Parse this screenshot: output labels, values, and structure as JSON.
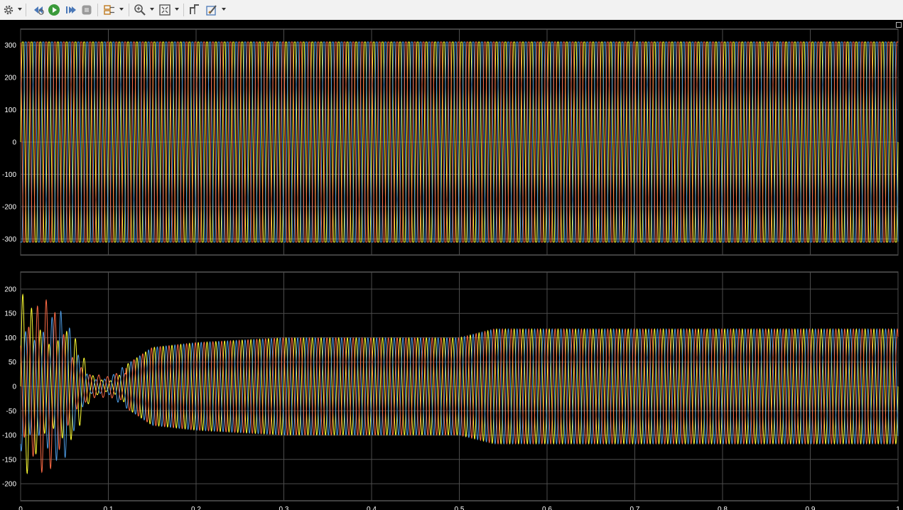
{
  "toolbar": {
    "icons": [
      "gear-icon",
      "step-back-icon",
      "run-icon",
      "step-forward-icon",
      "stop-icon",
      "highlight-icon",
      "zoom-in-icon",
      "fit-to-view-icon",
      "cursor-measure-icon",
      "triggers-icon"
    ]
  },
  "colors": {
    "background": "#000000",
    "grid": "#4d4d4d",
    "axes_frame": "#7f7f7f",
    "tick_text": "#ffffff",
    "phase_a": "#ffff33",
    "phase_b": "#4e9de6",
    "phase_c": "#ff6b45",
    "accent_green": "#42ff42"
  },
  "chart_data": [
    {
      "type": "line",
      "xlim": [
        0,
        1
      ],
      "ylim": [
        -350,
        350
      ],
      "x_ticks": [
        "0",
        "0.1",
        "0.2",
        "0.3",
        "0.4",
        "0.5",
        "0.6",
        "0.7",
        "0.8",
        "0.9",
        "1"
      ],
      "y_ticks": [
        "300",
        "200",
        "100",
        "0",
        "-100",
        "-200",
        "-300"
      ],
      "x_tick_values": [
        0,
        0.1,
        0.2,
        0.3,
        0.4,
        0.5,
        0.6,
        0.7,
        0.8,
        0.9,
        1
      ],
      "y_tick_values": [
        300,
        200,
        100,
        0,
        -100,
        -200,
        -300
      ],
      "grid": true,
      "frequency_hz": 100,
      "series": [
        {
          "color": "#ffff33",
          "amplitude": 310,
          "phase_deg": 0
        },
        {
          "color": "#4e9de6",
          "amplitude": 310,
          "phase_deg": -120
        },
        {
          "color": "#ff6b45",
          "amplitude": 310,
          "phase_deg": 120
        }
      ]
    },
    {
      "type": "line",
      "xlim": [
        0,
        1
      ],
      "ylim": [
        -235,
        235
      ],
      "x_ticks": [
        "0",
        "0.1",
        "0.2",
        "0.3",
        "0.4",
        "0.5",
        "0.6",
        "0.7",
        "0.8",
        "0.9",
        "1"
      ],
      "y_ticks": [
        "200",
        "150",
        "100",
        "50",
        "0",
        "-50",
        "-100",
        "-150",
        "-200"
      ],
      "x_tick_values": [
        0,
        0.1,
        0.2,
        0.3,
        0.4,
        0.5,
        0.6,
        0.7,
        0.8,
        0.9,
        1
      ],
      "y_tick_values": [
        200,
        150,
        100,
        50,
        0,
        -50,
        -100,
        -150,
        -200
      ],
      "grid": true,
      "frequency_hz": 100,
      "envelope": {
        "t": [
          0,
          0.02,
          0.05,
          0.08,
          0.1,
          0.15,
          0.2,
          0.3,
          0.5,
          0.54,
          0.6,
          1
        ],
        "amp": [
          190,
          190,
          150,
          30,
          20,
          80,
          90,
          100,
          100,
          118,
          118,
          118
        ]
      },
      "series": [
        {
          "color": "#ffff33",
          "phase_deg": 0
        },
        {
          "color": "#4e9de6",
          "phase_deg": -120
        },
        {
          "color": "#ff6b45",
          "phase_deg": 120
        }
      ]
    }
  ]
}
